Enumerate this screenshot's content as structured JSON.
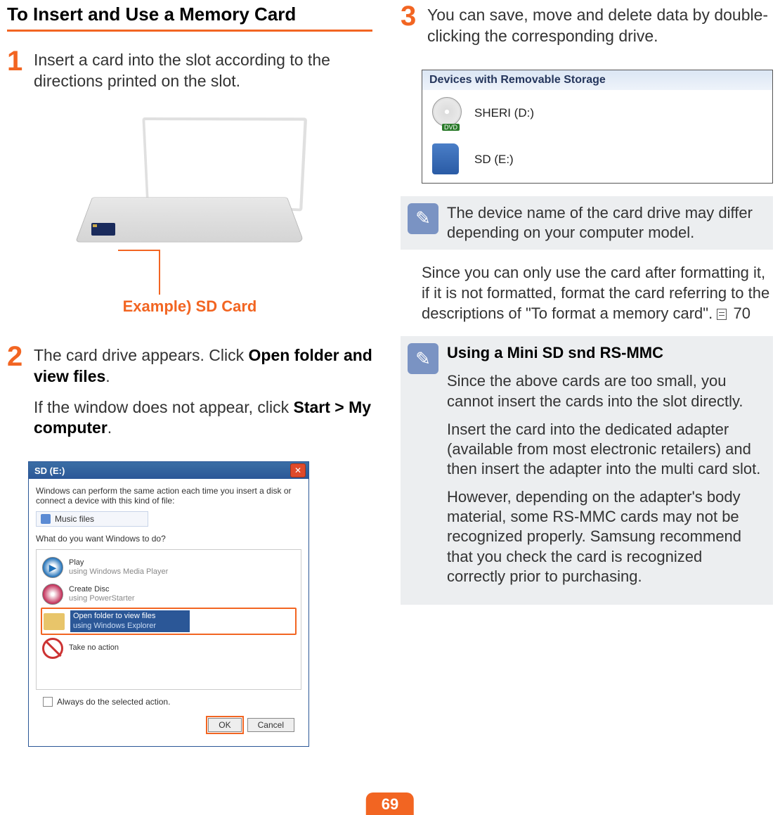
{
  "title": "To Insert and Use a Memory Card",
  "page_number": "69",
  "left": {
    "step1": {
      "num": "1",
      "text": "Insert a card into the slot according to the directions printed on the slot."
    },
    "laptop_caption": "Example) SD Card",
    "step2": {
      "num": "2",
      "text_a": "The card drive appears. Click ",
      "text_b_strong": "Open folder and view files",
      "text_c": ".",
      "text_d": "If the window does not appear, click ",
      "text_e_strong": "Start > My computer",
      "text_f": "."
    },
    "dialog": {
      "title": "SD (E:)",
      "intro": "Windows can perform the same action each time you insert a disk or connect a device with this kind of file:",
      "filetype": "Music files",
      "prompt": "What do you want Windows to do?",
      "opt_play": "Play",
      "opt_play_sub": "using Windows Media Player",
      "opt_create": "Create Disc",
      "opt_create_sub": "using PowerStarter",
      "opt_open": "Open folder to view files",
      "opt_open_sub": "using Windows Explorer",
      "opt_none": "Take no action",
      "always": "Always do the selected action.",
      "ok": "OK",
      "cancel": "Cancel"
    }
  },
  "right": {
    "step3": {
      "num": "3",
      "text": "You can save, move and delete data by double-clicking the corresponding drive."
    },
    "devices": {
      "header": "Devices with Removable Storage",
      "dvd": "SHERI (D:)",
      "dvd_badge": "DVD",
      "sd": "SD (E:)"
    },
    "note1": "The device name of the card drive may differ depending on your computer model.",
    "format_text_a": "Since you can only use the card after formatting it, if it is not formatted, format the card referring to the descriptions of \"To format a memory card\". ",
    "format_page": "70",
    "note2": {
      "title": "Using a Mini SD snd RS-MMC",
      "p1": "Since the above cards are too small, you cannot insert the cards into the slot directly.",
      "p2": "Insert the card into the dedicated adapter (available from most electronic retailers) and then insert the adapter into the multi card slot.",
      "p3": "However, depending on the adapter's body material, some RS-MMC cards may not be recognized properly. Samsung recommend that you check the card is recognized correctly prior to purchasing."
    }
  }
}
